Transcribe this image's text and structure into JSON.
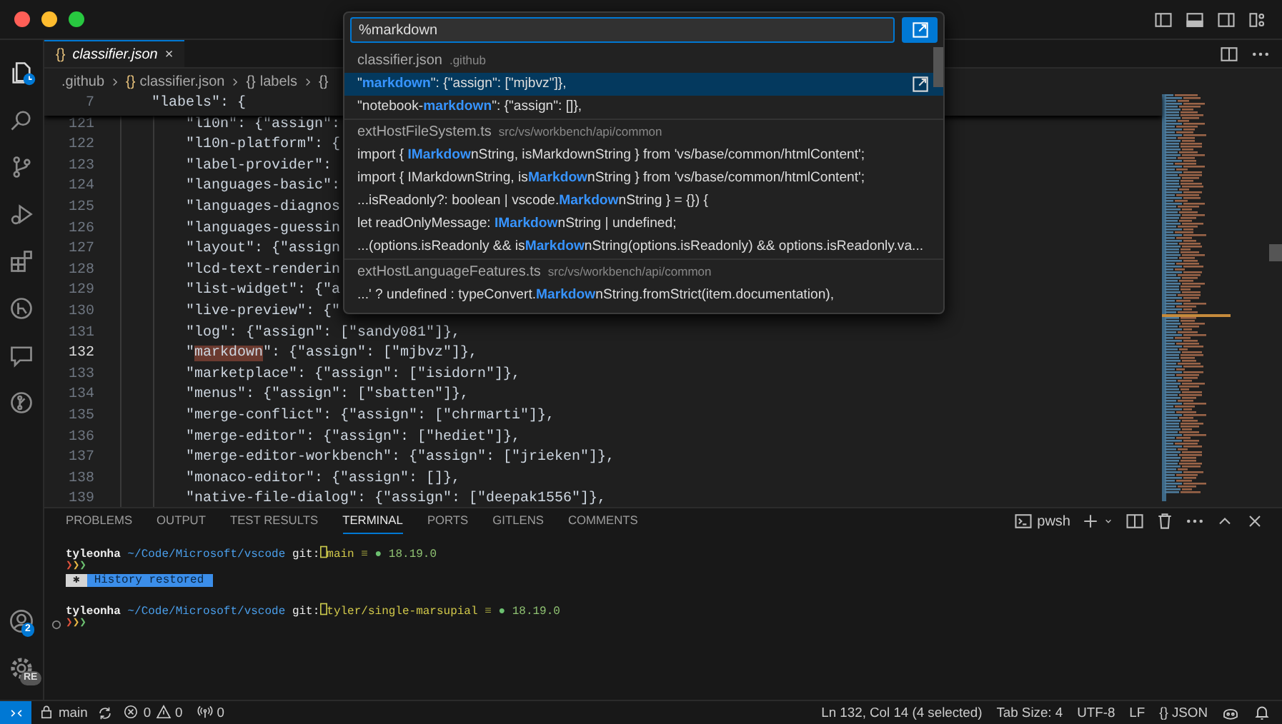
{
  "activity_bar": {
    "account_badge": "2",
    "manage_badge": "RE"
  },
  "editor_tab": {
    "icon": "{}",
    "label": "classifier.json",
    "close": "×"
  },
  "breadcrumbs": [
    {
      "label": ".github"
    },
    {
      "icon": "{}",
      "label": "classifier.json"
    },
    {
      "icon": "{}",
      "label": "labels"
    },
    {
      "icon": "{}"
    }
  ],
  "sticky_line": {
    "number": "7",
    "text": "\"labels\": {"
  },
  "lines": [
    {
      "number": "121",
      "current": false,
      "text": "\"l10n\": {\"assign\":"
    },
    {
      "number": "122",
      "current": false,
      "text": "\"l10n-platform\": {"
    },
    {
      "number": "123",
      "current": false,
      "text": "\"label-provider\":"
    },
    {
      "number": "124",
      "current": false,
      "text": "\"languages-basic\":"
    },
    {
      "number": "125",
      "current": false,
      "text": "\"languages-diagnos"
    },
    {
      "number": "126",
      "current": false,
      "text": "\"languages-guessin"
    },
    {
      "number": "127",
      "current": false,
      "text": "\"layout\": {\"assign"
    },
    {
      "number": "128",
      "current": false,
      "text": "\"lcd-text-renderin"
    },
    {
      "number": "129",
      "current": false,
      "text": "\"list-widget\": {\"a"
    },
    {
      "number": "130",
      "current": false,
      "text": "\"live-preview\": {\""
    },
    {
      "number": "131",
      "current": false,
      "text": "\"log\": {\"assign\": [\"sandy081\"]},"
    },
    {
      "number": "132",
      "current": true,
      "parts": [
        {
          "text": "\"",
          "highlighted": false
        },
        {
          "text": "markdown",
          "highlighted": true
        },
        {
          "text": "\": {\"assign\": [\"mjbvz\"]},",
          "highlighted": false
        }
      ]
    },
    {
      "number": "133",
      "current": false,
      "text": "\"marketplace\": {\"assign\": [\"isidorn\"]},"
    },
    {
      "number": "134",
      "current": false,
      "text": "\"menus\": {\"assign\": [\"sbatten\"]},"
    },
    {
      "number": "135",
      "current": false,
      "text": "\"merge-conflict\": {\"assign\": [\"chrmarti\"]},"
    },
    {
      "number": "136",
      "current": false,
      "text": "\"merge-editor\": {\"assign\": [\"hediet\"]},"
    },
    {
      "number": "137",
      "current": false,
      "text": "\"merge-editor-workbench\": {\"assign\": [\"jrieken\"]},"
    },
    {
      "number": "138",
      "current": false,
      "text": "\"monaco-editor\": {\"assign\": []},"
    },
    {
      "number": "139",
      "current": false,
      "text": "\"native-file-dialog\": {\"assign\": [\"deepak1556\"]},"
    }
  ],
  "quick_pick": {
    "value": "%markdown",
    "groups": [
      {
        "file": "classifier.json",
        "path": ".github",
        "results": [
          {
            "text": "\"**markdown**\": {\"assign\": [\"mjbvz\"]},",
            "selected": true
          },
          {
            "text": "\"notebook-**markdown**\": {\"assign\": []},",
            "selected": false
          }
        ]
      },
      {
        "file": "extHostFileSystem.ts",
        "path": "src/vs/workbench/api/common",
        "results": [
          {
            "text": "import { **IMarkdow**nString, isMarkdownString } from 'vs/base/common/htmlContent';",
            "selected": false
          },
          {
            "text": "import { IMarkdownString, is**Markdow**nString } from 'vs/base/common/htmlContent';",
            "selected": false
          },
          {
            "text": "...isReadonly?: boolean | vscode.**Markdow**nString } = {}) {",
            "selected": false
          },
          {
            "text": "let readOnlyMessage: **IMarkdow**nString | undefined;",
            "selected": false
          },
          {
            "text": "...(options.isReadonly && is**Markdow**nString(options.isReadonly) && options.isReadonly.va...",
            "selected": false
          }
        ]
      },
      {
        "file": "extHostLanguageFeatures.ts",
        "path": "src/vs/workbench/api/common",
        "results": [
          {
            "text": "...' ? undefined : typeConvert.**Markdow**nString.fromStrict(item.documentation),",
            "selected": false
          }
        ]
      }
    ]
  },
  "panel": {
    "tabs": [
      {
        "label": "PROBLEMS",
        "selected": false
      },
      {
        "label": "OUTPUT",
        "selected": false
      },
      {
        "label": "TEST RESULTS",
        "selected": false
      },
      {
        "label": "TERMINAL",
        "selected": true
      },
      {
        "label": "PORTS",
        "selected": false
      },
      {
        "label": "GITLENS",
        "selected": false
      },
      {
        "label": "COMMENTS",
        "selected": false
      }
    ],
    "terminal_name": "pwsh",
    "terminal_lines": [
      {
        "kind": "info",
        "user": "tyleonha",
        "path": "~/Code/Microsoft/vscode",
        "git": "git:",
        "branch": "main",
        "status": "≡",
        "dot": "●",
        "version": "18.19.0"
      },
      {
        "kind": "prompt",
        "decorated": false,
        "arrows": [
          {
            "text": "❯",
            "color": "#e0533d"
          },
          {
            "text": "❯",
            "color": "#e5b544"
          },
          {
            "text": "❯",
            "color": "#6cc070"
          }
        ]
      },
      {
        "kind": "notice",
        "mark": "✱",
        "text": "History restored"
      },
      {
        "kind": "blank"
      },
      {
        "kind": "info",
        "user": "tyleonha",
        "path": "~/Code/Microsoft/vscode",
        "git": "git:",
        "branch": "tyler/single-marsupial",
        "status": "≡",
        "dot": "●",
        "version": "18.19.0"
      },
      {
        "kind": "prompt",
        "decorated": true,
        "arrows": [
          {
            "text": "❯",
            "color": "#e0533d"
          },
          {
            "text": "❯",
            "color": "#e5b544"
          },
          {
            "text": "❯",
            "color": "#6cc070"
          }
        ]
      }
    ]
  },
  "status_bar": {
    "branch": "main",
    "errors": "0",
    "warnings": "0",
    "ports": "0",
    "position": "Ln 132, Col 14 (4 selected)",
    "tab_size": "Tab Size: 4",
    "encoding": "UTF-8",
    "eol": "LF",
    "language_icon": "{}",
    "language": "JSON"
  }
}
